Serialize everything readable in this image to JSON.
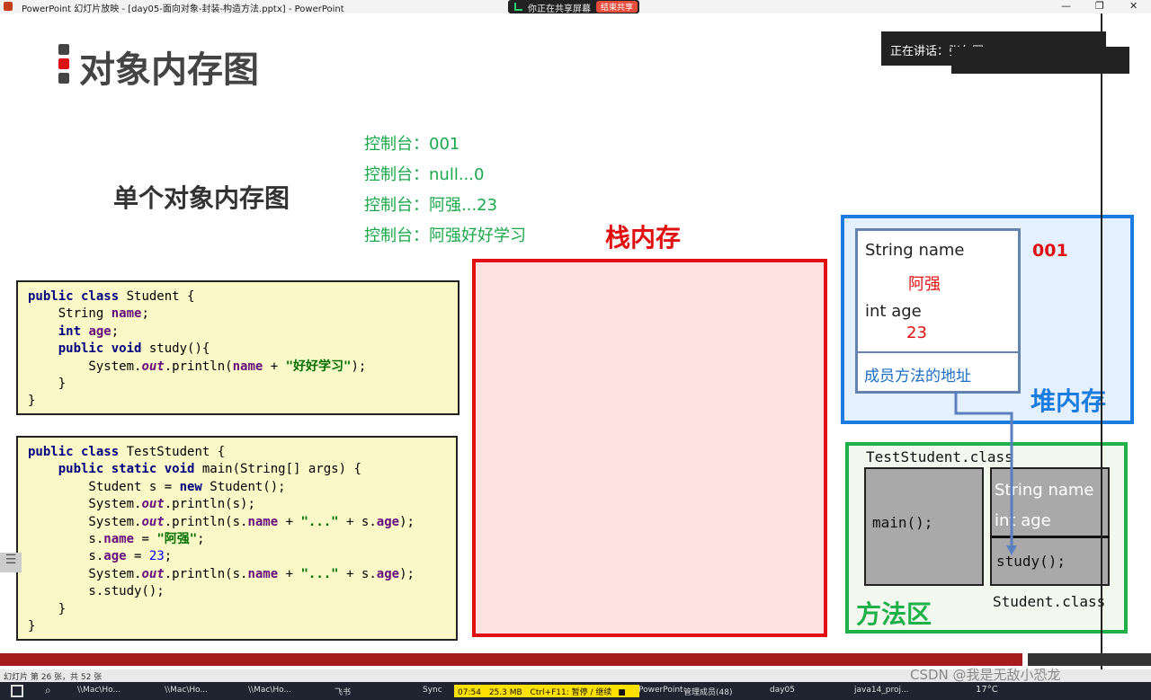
{
  "window": {
    "title": "PowerPoint 幻灯片放映 - [day05-面向对象-封装-构造方法.pptx] - PowerPoint",
    "share_text": "你正在共享屏幕",
    "end_share": "结束共享"
  },
  "speaker": "正在讲话：张久军;",
  "slide": {
    "title": "对象内存图",
    "subtitle": "单个对象内存图",
    "console": [
      "控制台：001",
      "控制台：null...0",
      "控制台：阿强...23",
      "控制台：阿强好好学习"
    ],
    "stack_label": "栈内存",
    "heap_label": "堆内存",
    "method_label": "方法区",
    "heap": {
      "field1": "String name",
      "val1": "阿强",
      "field2": "int age",
      "val2": "23",
      "method_addr": "成员方法的地址",
      "address": "001"
    },
    "method_area": {
      "class1": "TestStudent.class",
      "main": "main();",
      "f1": "String name",
      "f2": "int age",
      "study": "study();",
      "class2": "Student.class"
    }
  },
  "status": {
    "slide_info": "幻灯片 第 26 张，共 52 张",
    "watermark": "CSDN @我是无敌小恐龙"
  },
  "recorder": {
    "time": "07:54",
    "size": "25.3 MB",
    "hint": "Ctrl+F11: 暂停 / 继续"
  },
  "taskbar": {
    "items": [
      "\\\\Mac\\Ho...",
      "\\\\Mac\\Ho...",
      "\\\\Mac\\Ho...",
      "飞书",
      "Sync",
      "PowerPoint",
      "管理成员(48)",
      "day05",
      "java14_proj..."
    ],
    "temp": "17°C"
  }
}
